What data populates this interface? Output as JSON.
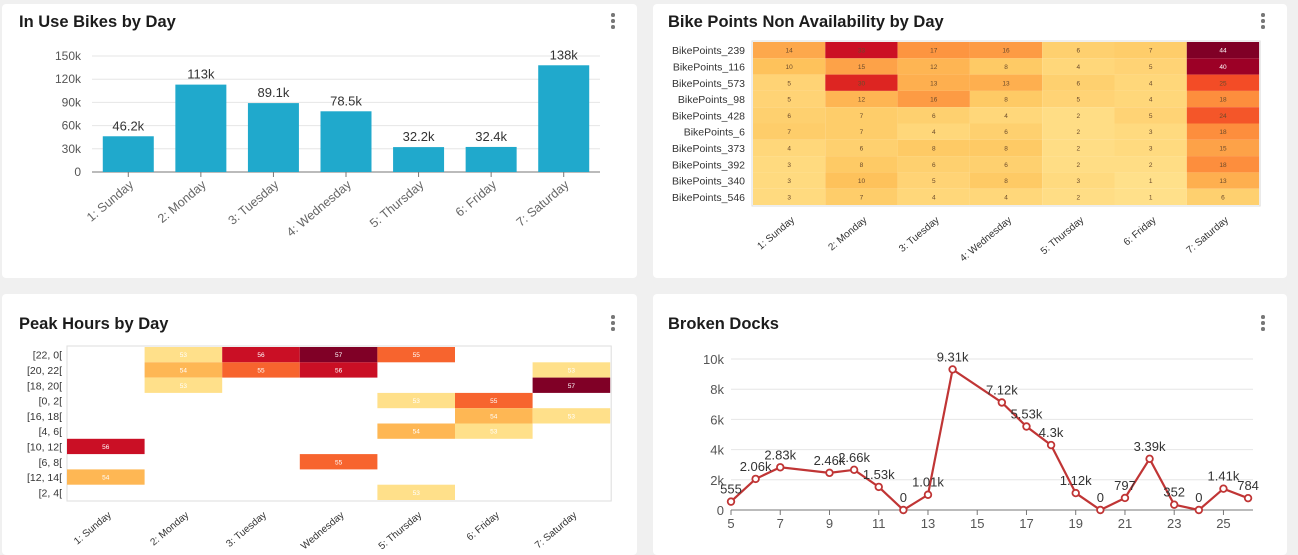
{
  "panels": {
    "bikes": {
      "title": "In Use Bikes by Day"
    },
    "nonavail": {
      "title": "Bike Points Non Availability by Day"
    },
    "peak": {
      "title": "Peak Hours by Day"
    },
    "broken": {
      "title": "Broken Docks"
    }
  },
  "colors": {
    "bar": "#20a9cc",
    "line": "#c03535",
    "heat_scale": [
      "#ffe08a",
      "#fec55c",
      "#fd8d3c",
      "#f03b20",
      "#bd0026",
      "#800026"
    ]
  },
  "chart_data": [
    {
      "id": "in-use-bikes",
      "type": "bar",
      "title": "In Use Bikes by Day",
      "categories": [
        "1: Sunday",
        "2: Monday",
        "3: Tuesday",
        "4: Wednesday",
        "5: Thursday",
        "6: Friday",
        "7: Saturday"
      ],
      "values": [
        46200,
        113000,
        89100,
        78500,
        32200,
        32400,
        138000
      ],
      "value_labels": [
        "46.2k",
        "113k",
        "89.1k",
        "78.5k",
        "32.2k",
        "32.4k",
        "138k"
      ],
      "ylim": [
        0,
        150000
      ],
      "yticks": [
        0,
        30000,
        60000,
        90000,
        120000,
        150000
      ],
      "ytick_labels": [
        "0",
        "30k",
        "60k",
        "90k",
        "120k",
        "150k"
      ],
      "grid": true
    },
    {
      "id": "non-availability",
      "type": "heatmap",
      "title": "Bike Points Non Availability by Day",
      "x": [
        "1: Sunday",
        "2: Monday",
        "3: Tuesday",
        "4: Wednesday",
        "5: Thursday",
        "6: Friday",
        "7: Saturday"
      ],
      "x_labels": [
        "1: Sunday",
        "2: Monday",
        "3: Tuesday",
        "4: Wednesday",
        "5: Thursday",
        "6: Friday",
        "7: Saturday"
      ],
      "y": [
        "BikePoints_239",
        "BikePoints_116",
        "BikePoints_573",
        "BikePoints_98",
        "BikePoints_428",
        "BikePoints_6",
        "BikePoints_373",
        "BikePoints_392",
        "BikePoints_340",
        "BikePoints_546"
      ],
      "values": [
        [
          14,
          33,
          17,
          16,
          6,
          7,
          44
        ],
        [
          10,
          15,
          12,
          8,
          4,
          5,
          40
        ],
        [
          5,
          30,
          13,
          13,
          6,
          4,
          25
        ],
        [
          5,
          12,
          16,
          8,
          5,
          4,
          18
        ],
        [
          6,
          7,
          6,
          4,
          2,
          5,
          24
        ],
        [
          7,
          7,
          4,
          6,
          2,
          3,
          18
        ],
        [
          4,
          6,
          8,
          8,
          2,
          3,
          15
        ],
        [
          3,
          8,
          6,
          6,
          2,
          2,
          18
        ],
        [
          3,
          10,
          5,
          8,
          3,
          1,
          13
        ],
        [
          3,
          7,
          4,
          4,
          2,
          1,
          6
        ]
      ]
    },
    {
      "id": "peak-hours",
      "type": "heatmap",
      "title": "Peak Hours by Day",
      "x": [
        "1: Sunday",
        "2: Monday",
        "3: Tuesday",
        "Wednesday",
        "5: Thursday",
        "6: Friday",
        "7: Saturday"
      ],
      "y": [
        "[22, 0[",
        "[20, 22[",
        "[18, 20[",
        "[0, 2[",
        "[16, 18[",
        "[4, 6[",
        "[10, 12[",
        "[6, 8[",
        "[12, 14[",
        "[2, 4["
      ],
      "values": [
        [
          null,
          53,
          56,
          57,
          55,
          null,
          null
        ],
        [
          null,
          54,
          55,
          56,
          null,
          null,
          53
        ],
        [
          null,
          53,
          null,
          null,
          null,
          null,
          57
        ],
        [
          null,
          null,
          null,
          null,
          53,
          55,
          null
        ],
        [
          null,
          null,
          null,
          null,
          null,
          54,
          53
        ],
        [
          null,
          null,
          null,
          null,
          54,
          53,
          null
        ],
        [
          56,
          null,
          null,
          null,
          null,
          null,
          null
        ],
        [
          null,
          null,
          null,
          55,
          null,
          null,
          null
        ],
        [
          54,
          null,
          null,
          null,
          null,
          null,
          null
        ],
        [
          null,
          null,
          null,
          null,
          53,
          null,
          null
        ]
      ]
    },
    {
      "id": "broken-docks",
      "type": "line",
      "title": "Broken Docks",
      "x": [
        5,
        6,
        7,
        9,
        10,
        11,
        12,
        13,
        14,
        16,
        17,
        18,
        19,
        20,
        21,
        22,
        23,
        24,
        25,
        26
      ],
      "values": [
        555,
        2060,
        2830,
        2460,
        2660,
        1530,
        0,
        1010,
        9310,
        7120,
        5530,
        4300,
        1120,
        0,
        797,
        3390,
        352,
        0,
        1410,
        784
      ],
      "value_labels": [
        "555",
        "2.06k",
        "2.83k",
        "2.46k",
        "2.66k",
        "1.53k",
        "0",
        "1.01k",
        "9.31k",
        "7.12k",
        "5.53k",
        "4.3k",
        "1.12k",
        "0",
        "797",
        "3.39k",
        "352",
        "0",
        "1.41k",
        "784"
      ],
      "xlim": [
        5,
        26.2
      ],
      "xticks": [
        5,
        7,
        9,
        11,
        13,
        15,
        17,
        19,
        21,
        23,
        25
      ],
      "ylim": [
        0,
        10000
      ],
      "yticks": [
        0,
        2000,
        4000,
        6000,
        8000,
        10000
      ],
      "ytick_labels": [
        "0",
        "2k",
        "4k",
        "6k",
        "8k",
        "10k"
      ],
      "grid": true
    }
  ]
}
